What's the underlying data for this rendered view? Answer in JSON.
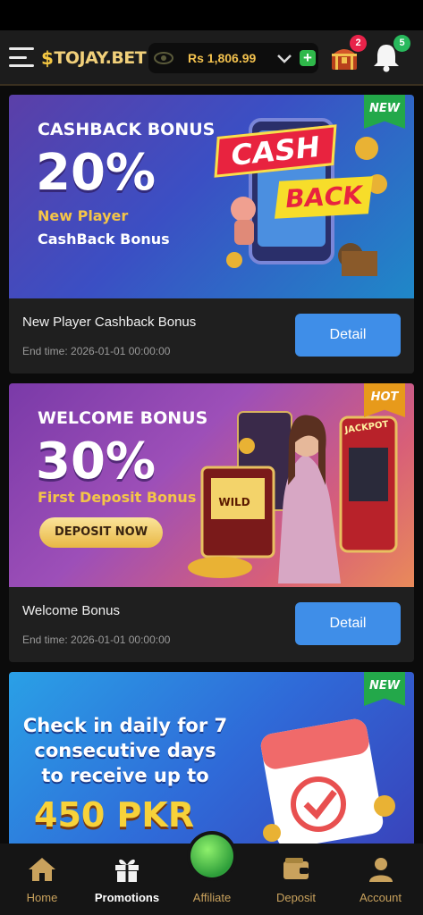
{
  "header": {
    "logo_symbol": "$",
    "logo_text": "TOJAY.BET",
    "balance": "Rs 1,806.99",
    "chest_badge": "2",
    "notification_badge": "5",
    "icons": [
      "menu-icon",
      "eye-icon",
      "chevron-down-icon",
      "plus-icon",
      "treasure-chest-icon",
      "bell-icon"
    ]
  },
  "promotions": [
    {
      "tag": "NEW",
      "tag_color": "#23a84a",
      "banner": {
        "heading": "CASHBACK BONUS",
        "percent": "20%",
        "line1": "New Player",
        "line2": "CashBack Bonus",
        "art_text_1": "CASH",
        "art_text_2": "BACK"
      },
      "title": "New Player Cashback Bonus",
      "end_time": "End time: 2026-01-01 00:00:00",
      "button": "Detail"
    },
    {
      "tag": "HOT",
      "tag_color": "#e79a1b",
      "banner": {
        "heading": "WELCOME BONUS",
        "percent": "30%",
        "line1": "First Deposit Bonus",
        "cta": "DEPOSIT NOW",
        "art_text_1": "JACKPOT",
        "art_text_2": "WILD"
      },
      "title": "Welcome Bonus",
      "end_time": "End time: 2026-01-01 00:00:00",
      "button": "Detail"
    },
    {
      "tag": "NEW",
      "tag_color": "#23a84a",
      "banner": {
        "line1": "Check in daily for 7",
        "line2": "consecutive days",
        "line3": "to receive up to",
        "amount": "450 PKR"
      }
    }
  ],
  "bottom_nav": {
    "items": [
      {
        "label": "Home",
        "icon": "home-icon"
      },
      {
        "label": "Promotions",
        "icon": "gift-icon",
        "active": true
      },
      {
        "label": "Affiliate",
        "icon": "affiliate-icon"
      },
      {
        "label": "Deposit",
        "icon": "wallet-icon"
      },
      {
        "label": "Account",
        "icon": "user-icon"
      }
    ]
  },
  "colors": {
    "accent_gold": "#f2c14e",
    "button_blue": "#3f8ee8",
    "nav_label": "#c9a25d"
  }
}
